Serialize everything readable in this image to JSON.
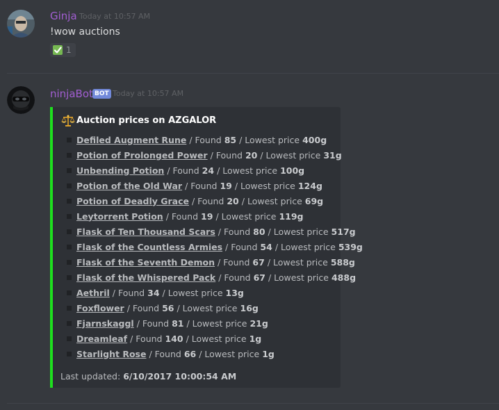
{
  "messages": [
    {
      "username": "Ginja",
      "username_color": "#a25ed2",
      "timestamp": "Today at 10:57 AM",
      "content": "!wow auctions",
      "reaction": {
        "icon": "check-mark-icon",
        "count": "1"
      }
    },
    {
      "username": "ninjaBot",
      "username_color": "#a25ed2",
      "badge": "BOT",
      "timestamp": "Today at 10:57 AM",
      "embed": {
        "accent_color": "#1ee01e",
        "title_icon": "scales-icon",
        "title": "Auction prices on AZGALOR",
        "found_label": "/ Found",
        "price_label": "/ Lowest price",
        "items": [
          {
            "name": "Defiled Augment Rune",
            "found": "85",
            "price": "400g"
          },
          {
            "name": "Potion of Prolonged Power",
            "found": "20",
            "price": "31g"
          },
          {
            "name": "Unbending Potion",
            "found": "24",
            "price": "100g"
          },
          {
            "name": "Potion of the Old War",
            "found": "19",
            "price": "124g"
          },
          {
            "name": "Potion of Deadly Grace",
            "found": "20",
            "price": "69g"
          },
          {
            "name": "Leytorrent Potion",
            "found": "19",
            "price": "119g"
          },
          {
            "name": "Flask of Ten Thousand Scars",
            "found": "80",
            "price": "517g"
          },
          {
            "name": "Flask of the Countless Armies",
            "found": "54",
            "price": "539g"
          },
          {
            "name": "Flask of the Seventh Demon",
            "found": "67",
            "price": "588g"
          },
          {
            "name": "Flask of the Whispered Pack",
            "found": "67",
            "price": "488g"
          },
          {
            "name": "Aethril",
            "found": "34",
            "price": "13g"
          },
          {
            "name": "Foxflower",
            "found": "56",
            "price": "16g"
          },
          {
            "name": "Fjarnskaggl",
            "found": "81",
            "price": "21g"
          },
          {
            "name": "Dreamleaf",
            "found": "140",
            "price": "1g"
          },
          {
            "name": "Starlight Rose",
            "found": "66",
            "price": "1g"
          }
        ],
        "footer_label": "Last updated:",
        "footer_value": "6/10/2017 10:00:54 AM"
      }
    }
  ]
}
